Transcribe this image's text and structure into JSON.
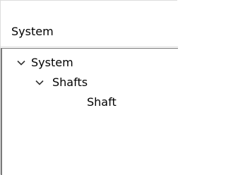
{
  "header": {
    "title": "System"
  },
  "tree": {
    "nodes": [
      {
        "label": "System",
        "expanded": true,
        "icon": "chevron-down-icon"
      },
      {
        "label": "Shafts",
        "expanded": true,
        "icon": "chevron-down-icon"
      },
      {
        "label": "Shaft"
      }
    ]
  }
}
